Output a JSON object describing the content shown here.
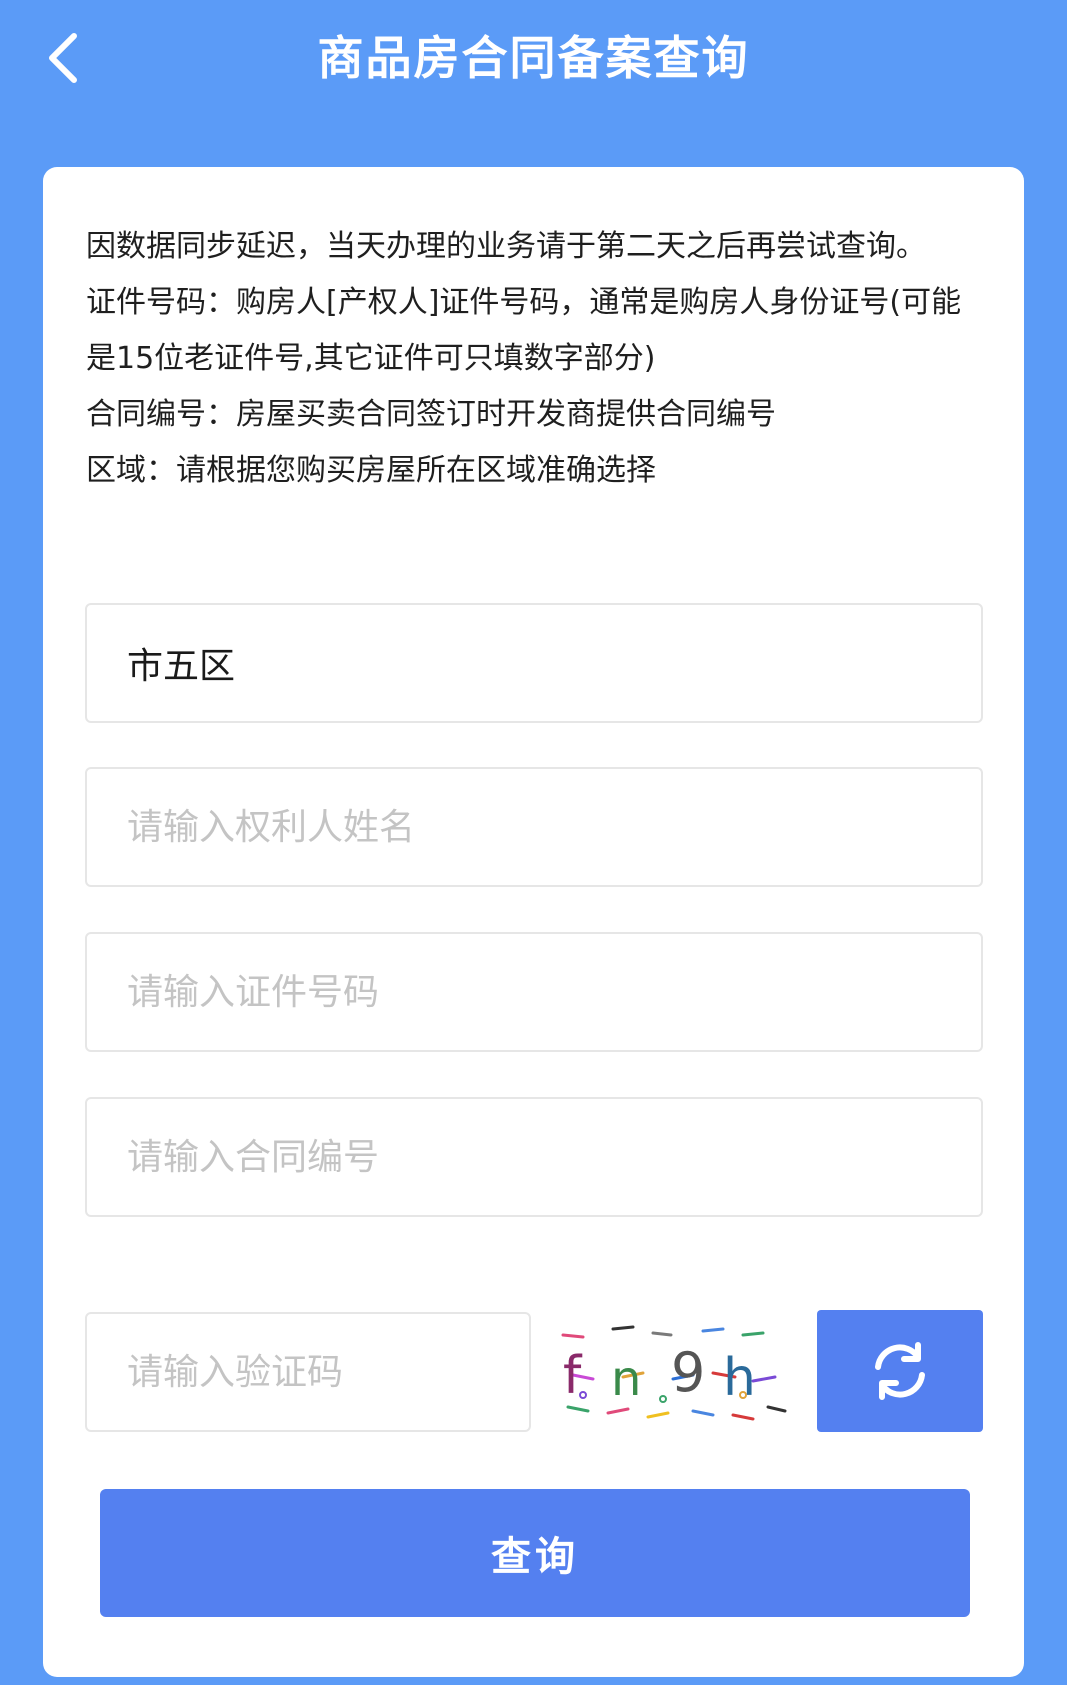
{
  "header": {
    "title": "商品房合同备案查询",
    "back_icon": "chevron-left-icon"
  },
  "notice": {
    "lines": [
      "因数据同步延迟，当天办理的业务请于第二天之后再尝试查询。",
      "证件号码：购房人[产权人]证件号码，通常是购房人身份证号(可能是15位老证件号,其它证件可只填数字部分)",
      "合同编号：房屋买卖合同签订时开发商提供合同编号",
      "区域：请根据您购买房屋所在区域准确选择"
    ]
  },
  "form": {
    "region_value": "市五区",
    "name_placeholder": "请输入权利人姓名",
    "id_placeholder": "请输入证件号码",
    "contract_placeholder": "请输入合同编号",
    "captcha_placeholder": "请输入验证码",
    "captcha_text": "fn9h",
    "refresh_icon": "refresh-icon",
    "submit_label": "查询"
  },
  "colors": {
    "background": "#5b9bf7",
    "button": "#5480f0",
    "placeholder": "#c4c4c4"
  }
}
